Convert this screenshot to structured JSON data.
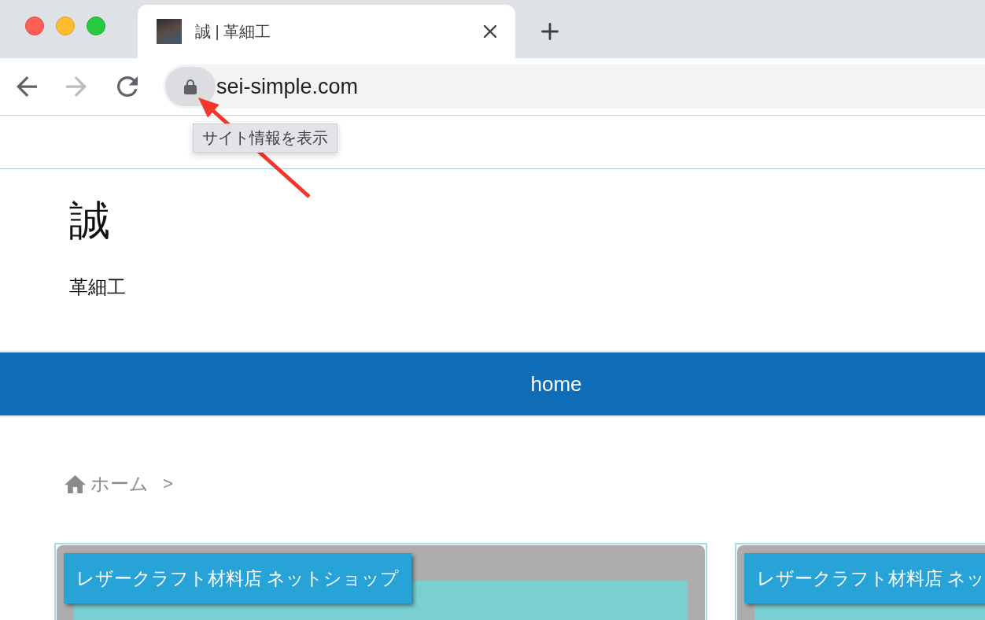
{
  "browser": {
    "tabs": [
      {
        "title": "誠 | 革細工",
        "selected": true
      }
    ],
    "nav_buttons": [
      {
        "kind": "back",
        "disabled": false
      },
      {
        "kind": "forward",
        "disabled": true
      },
      {
        "kind": "reload",
        "disabled": false
      }
    ],
    "address_bar": {
      "url": "sei-simple.com"
    },
    "tooltip": {
      "text": "サイト情報を表示"
    }
  },
  "site": {
    "title": "誠",
    "tagline": "革細工"
  },
  "nav": {
    "items": [
      {
        "label": "home"
      }
    ]
  },
  "breadcrumb": {
    "items": [
      {
        "label": "ホーム"
      }
    ],
    "separator": ">"
  },
  "cards": [
    {
      "label": "レザークラフト材料店 ネットショップ"
    },
    {
      "label": "レザークラフト材料店 ネッ"
    }
  ]
}
